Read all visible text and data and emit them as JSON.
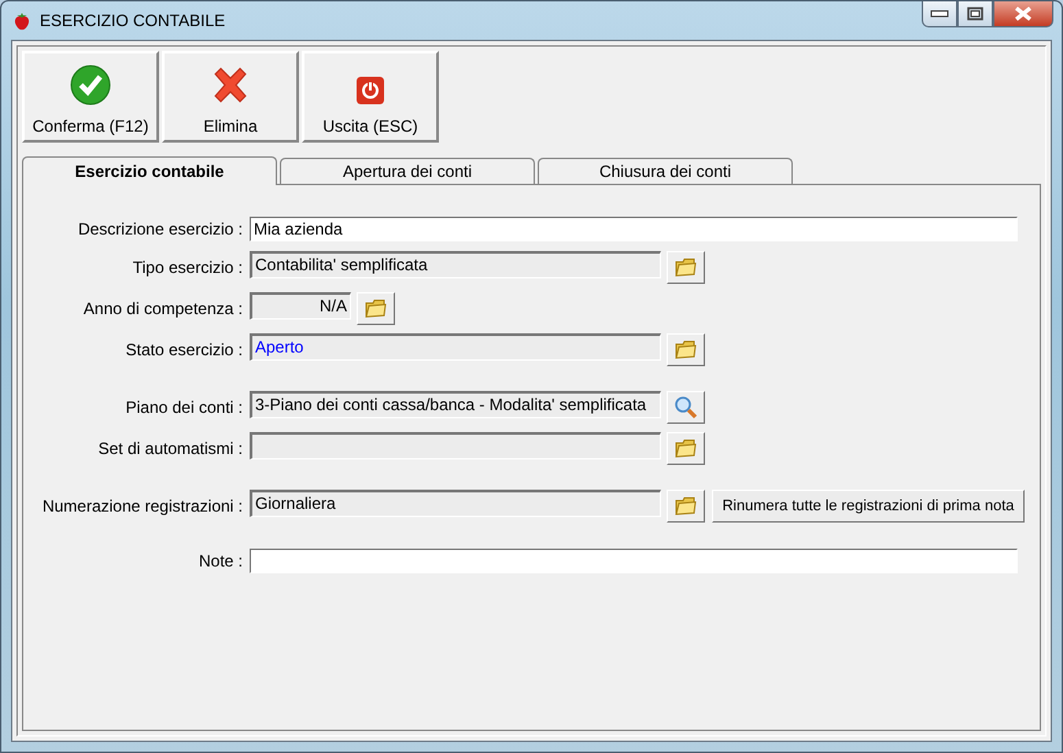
{
  "window": {
    "title": "ESERCIZIO CONTABILE"
  },
  "toolbar": [
    {
      "label": "Conferma (F12)",
      "kind": "confirm"
    },
    {
      "label": "Elimina",
      "kind": "delete"
    },
    {
      "label": "Uscita (ESC)",
      "kind": "exit"
    }
  ],
  "tabs": [
    {
      "label": "Esercizio contabile",
      "selected": true
    },
    {
      "label": "Apertura dei conti",
      "selected": false
    },
    {
      "label": "Chiusura dei conti",
      "selected": false
    }
  ],
  "sections": [
    {
      "fields": [
        {
          "label": "Descrizione esercizio :",
          "kind": "input",
          "value": "Mia azienda"
        },
        {
          "label": "Tipo esercizio :",
          "kind": "lookup",
          "value": "Contabilita' semplificata",
          "button": {
            "kind": "browse"
          }
        },
        {
          "label": "Anno di competenza :",
          "kind": "short",
          "value": "N/A",
          "button": {
            "kind": "browse"
          }
        },
        {
          "label": "Stato esercizio :",
          "kind": "lookup",
          "value": "Aperto",
          "color": "#0000ff",
          "button": {
            "kind": "browse"
          }
        }
      ]
    },
    {
      "fields": [
        {
          "label": "Piano dei conti :",
          "kind": "lookup",
          "value": "3-Piano dei conti cassa/banca - Modalita' semplificata",
          "button": {
            "kind": "search"
          }
        },
        {
          "label": "Set di automatismi :",
          "kind": "lookup",
          "button": {
            "kind": "browse"
          }
        }
      ]
    },
    {
      "fields": [
        {
          "label": "Numerazione registrazioni :",
          "kind": "lookup",
          "value": "Giornaliera",
          "button": {
            "kind": "browse"
          },
          "action": "Rinumera tutte le registrazioni di prima nota"
        }
      ]
    },
    {
      "fields": [
        {
          "label": "Note :",
          "kind": "input"
        }
      ]
    }
  ]
}
